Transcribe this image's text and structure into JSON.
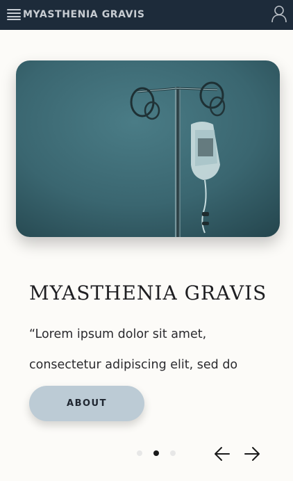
{
  "header": {
    "menu_icon": "hamburger-menu-icon",
    "title": "MYASTHENIA GRAVIS",
    "account_icon": "user-account-icon",
    "background_color": "#1d2b3a"
  },
  "hero": {
    "image_subject": "IV drip stand with infusion bag",
    "tint_color": "#3a6872"
  },
  "slide": {
    "title": "MYASTHENIA GRAVIS",
    "text": "“Lorem ipsum dolor sit amet, consectetur adipiscing elit, sed do",
    "button_label": "ABOUT",
    "button_color": "#bccbd5"
  },
  "carousel": {
    "slide_count": 3,
    "active_index": 1,
    "prev_icon": "arrow-left-icon",
    "next_icon": "arrow-right-icon"
  }
}
